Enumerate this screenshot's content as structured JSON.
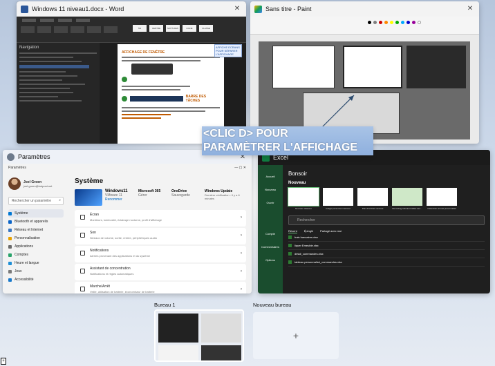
{
  "windows": {
    "word": {
      "title": "Windows 11 niveau1.docx - Word",
      "nav_title": "Navigation",
      "heading": "AFFICHAGE DE FENÊTRE",
      "taskbar_heading": "BARRE DES TÂCHES",
      "note": "AFFICHE ECRANS POUR SÉPARER L'AFFICHAGE",
      "ribbon_boxes": [
        "SN",
        "CENTRE",
        "MOTS RES",
        "LIGNE",
        "CLASSE"
      ]
    },
    "paint": {
      "title": "Sans titre - Paint"
    },
    "settings": {
      "title": "Paramètres",
      "subtitle": "Paramètres",
      "user_name": "Joel Groen",
      "user_email": "joel.groen@hotpost.net",
      "search_placeholder": "Rechercher un paramètre",
      "page_title": "Système",
      "pc_name": "Windows11",
      "pc_sub": "VMware 11",
      "pc_rename": "Renommer",
      "ms365": "Microsoft 365",
      "ms365_sub": "Gérer",
      "onedrive": "OneDrive",
      "onedrive_sub": "Sauvegarde",
      "update": "Windows Update",
      "update_sub": "Dernière vérification : Il y a 6 minutes",
      "nav": [
        "Système",
        "Bluetooth et appareils",
        "Réseau et Internet",
        "Personnalisation",
        "Applications",
        "Comptes",
        "Heure et langue",
        "Jeux",
        "Accessibilité"
      ],
      "rows": [
        {
          "title": "Écran",
          "sub": "Moniteurs, luminosité, éclairage nocturne, profil d'affichage"
        },
        {
          "title": "Son",
          "sub": "Niveaux de volume, sortie, entrée, périphériques audio"
        },
        {
          "title": "Notifications",
          "sub": "Alertes provenant des applications et du système"
        },
        {
          "title": "Assistant de concentration",
          "sub": "Notifications et règles automatiques"
        },
        {
          "title": "Marche/Arrêt",
          "sub": "Veille, utilisation de batterie, économiseur de batterie"
        }
      ]
    },
    "excel": {
      "title": "Excel",
      "greeting": "Bonsoir",
      "new_label": "Nouveau",
      "side": [
        "Accueil",
        "Nouveau",
        "Ouvrir",
        "Compte",
        "Commentaires",
        "Options"
      ],
      "templates": [
        "Nouveau classeur",
        "budget personnel mensuel",
        "Plan d'activité mensuel",
        "Recording turbulent tables des...",
        "Calendrier annuel personnalisé"
      ],
      "search_placeholder": "Rechercher",
      "tabs": [
        "Récent",
        "Épinglé",
        "Partagé avec moi"
      ],
      "files": [
        "frais bancaires.xlsx",
        "liquer Emeuble.xlsx",
        "détail_commandes.xlsx",
        "tableau personnalisé_commandes.xlsx"
      ]
    }
  },
  "callout": {
    "line1": "<CLIC D> POUR",
    "line2": "PARAMÈTRER L'AFFICHAGE"
  },
  "desktops": {
    "d1_label": "Bureau 1",
    "d2_label": "Nouveau bureau",
    "add_symbol": "+"
  }
}
